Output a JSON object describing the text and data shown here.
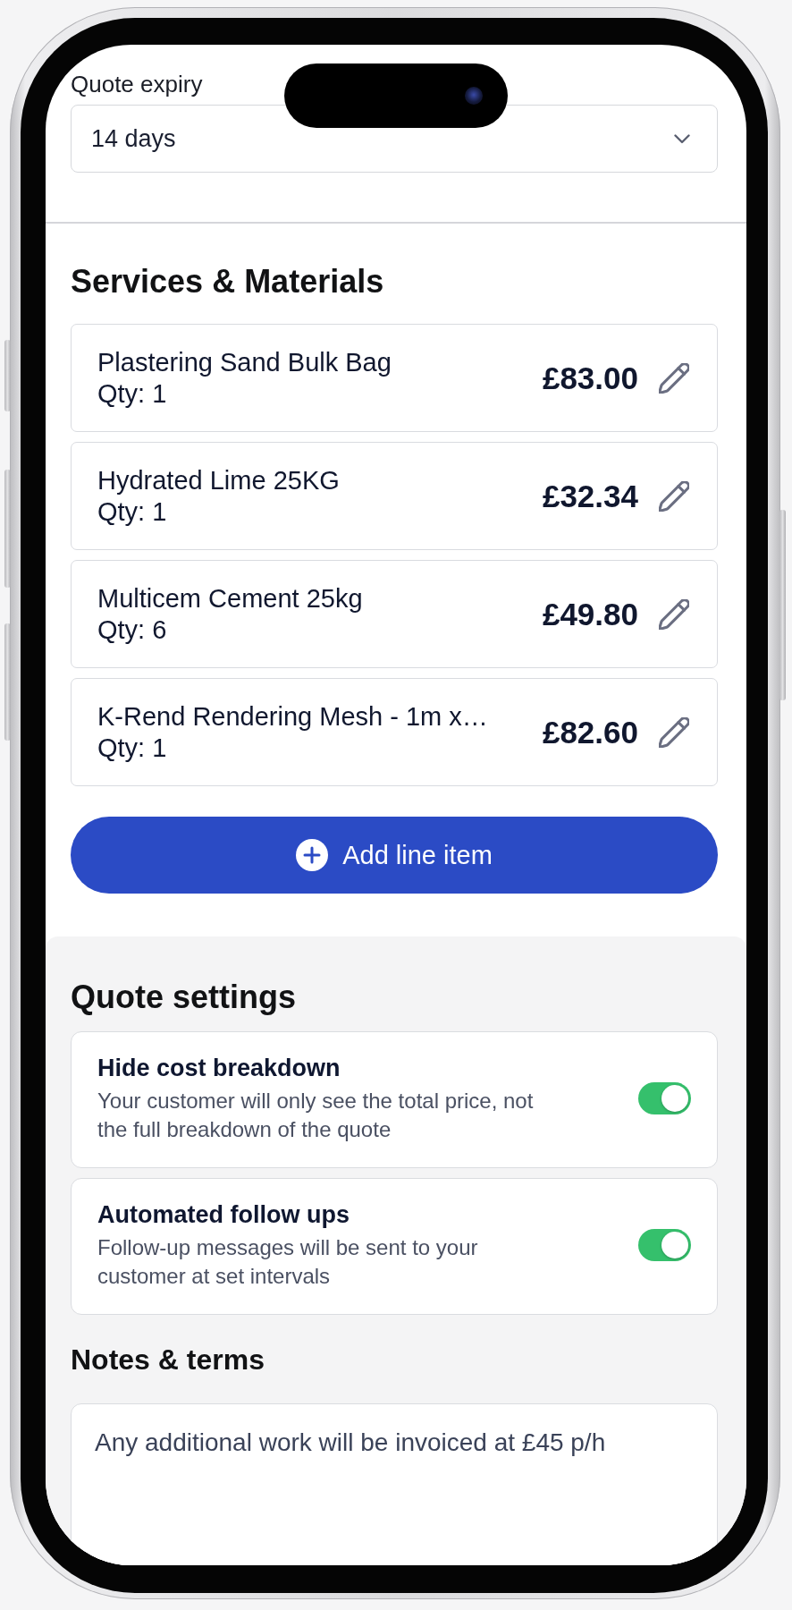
{
  "quote_expiry": {
    "label": "Quote expiry",
    "value": "14 days"
  },
  "services": {
    "title": "Services & Materials",
    "items": [
      {
        "name": "Plastering Sand Bulk Bag",
        "quantity": "Qty: 1",
        "price": "£83.00"
      },
      {
        "name": "Hydrated Lime 25KG",
        "quantity": "Qty: 1",
        "price": "£32.34"
      },
      {
        "name": "Multicem Cement 25kg",
        "quantity": "Qty: 6",
        "price": "£49.80"
      },
      {
        "name": "K-Rend Rendering Mesh - 1m x…",
        "quantity": "Qty: 1",
        "price": "£82.60"
      }
    ],
    "add_button": "Add line item"
  },
  "quote_settings": {
    "title": "Quote settings",
    "settings": [
      {
        "title": "Hide cost breakdown",
        "description": "Your customer will only see the total price, not the full breakdown of the quote",
        "on": true
      },
      {
        "title": "Automated follow ups",
        "description": "Follow-up messages will be sent to your customer at set intervals",
        "on": true
      }
    ]
  },
  "notes": {
    "title": "Notes & terms",
    "value": "Any additional work will be invoiced at £45 p/h"
  }
}
